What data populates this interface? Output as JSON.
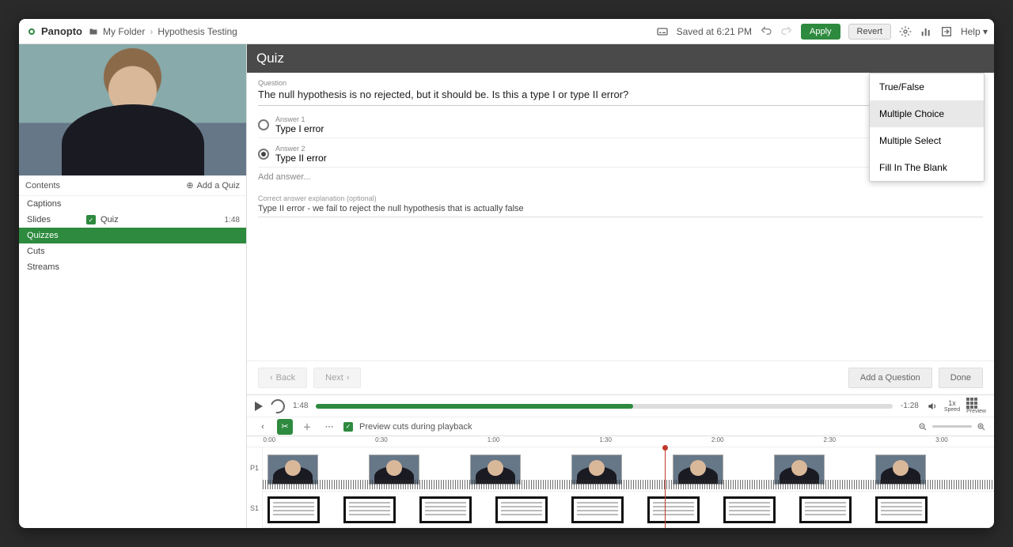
{
  "brand": "Panopto",
  "breadcrumb": {
    "folder": "My Folder",
    "title": "Hypothesis Testing"
  },
  "saved": "Saved at 6:21 PM",
  "buttons": {
    "apply": "Apply",
    "revert": "Revert",
    "help": "Help"
  },
  "nav": {
    "items": [
      "Contents",
      "Captions",
      "Slides",
      "Quizzes",
      "Cuts",
      "Streams"
    ],
    "active": "Quizzes",
    "addQuiz": "Add a Quiz"
  },
  "quizEntry": {
    "label": "Quiz",
    "time": "1:48"
  },
  "quiz": {
    "header": "Quiz",
    "questionLabel": "Question",
    "questionText": "The null hypothesis is no rejected, but it should be. Is this a type I or type II error?",
    "answers": [
      {
        "label": "Answer 1",
        "text": "Type I error",
        "selected": false
      },
      {
        "label": "Answer 2",
        "text": "Type II error",
        "selected": true
      }
    ],
    "addAnswer": "Add answer...",
    "explanationLabel": "Correct answer explanation (optional)",
    "explanation": "Type II error - we fail to reject the null hypothesis that is actually false",
    "typeOptions": [
      "True/False",
      "Multiple Choice",
      "Multiple Select",
      "Fill In The Blank"
    ],
    "typeSelected": "Multiple Choice",
    "footer": {
      "back": "Back",
      "next": "Next",
      "addQuestion": "Add a Question",
      "done": "Done"
    }
  },
  "player": {
    "current": "1:48",
    "remaining": "-1:28",
    "speed": "1x",
    "speedLabel": "Speed",
    "previewLabel": "Preview"
  },
  "tools": {
    "previewCuts": "Preview cuts during playback"
  },
  "ruler": [
    "0:00",
    "0:30",
    "1:00",
    "1:30",
    "2:00",
    "2:30",
    "3:00"
  ],
  "tracks": {
    "p": "P1",
    "s": "S1"
  }
}
